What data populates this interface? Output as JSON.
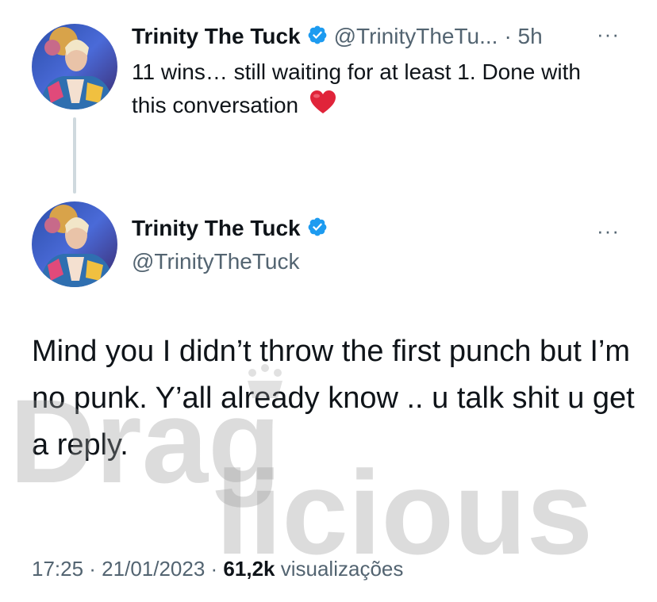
{
  "reply_tweet": {
    "author_name": "Trinity The Tuck",
    "author_handle": "@TrinityTheTu...",
    "time_ago": "· 5h",
    "more": "···",
    "text": "11 wins… still waiting for at least 1. Done with this conversation"
  },
  "main_tweet": {
    "author_name": "Trinity The Tuck",
    "author_handle": "@TrinityTheTuck",
    "more": "···",
    "text": "Mind you I didn’t throw the first punch but I’m no punk. Y’all already know .. u talk shit u get a reply.",
    "timestamp": "17:25 · 21/01/2023 ·",
    "views_count": "61,2k",
    "views_label": "visualizações"
  },
  "watermark": {
    "line1": "Drag",
    "line2": "licious"
  },
  "colors": {
    "verified": "#1d9bf0",
    "secondary_text": "#536471",
    "heart": "#e0243a"
  }
}
